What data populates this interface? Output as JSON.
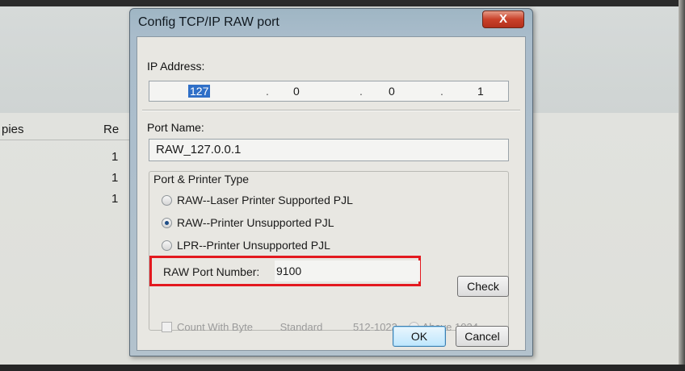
{
  "background": {
    "column_headers": [
      "pies",
      "Re"
    ],
    "rows": [
      "1",
      "1",
      "1"
    ]
  },
  "dialog": {
    "title": "Config TCP/IP RAW port",
    "close_label": "X",
    "ip_label": "IP Address:",
    "ip": [
      "127",
      "0",
      "0",
      "1"
    ],
    "port_name_label": "Port Name:",
    "port_name": "RAW_127.0.0.1",
    "group_title": "Port & Printer Type",
    "options": [
      {
        "label": "RAW--Laser Printer Supported PJL",
        "selected": false
      },
      {
        "label": "RAW--Printer Unsupported PJL",
        "selected": true
      },
      {
        "label": "LPR--Printer Unsupported PJL",
        "selected": false
      }
    ],
    "raw_port_label": "RAW Port Number:",
    "raw_port_value": "9100",
    "check_label": "Check",
    "count_with_byte": "Count With Byte",
    "standard": "Standard",
    "range": "512-1023",
    "above": "Above 1024",
    "ok_label": "OK",
    "cancel_label": "Cancel"
  },
  "colors": {
    "highlight_box": "#e3191f",
    "ip_selection": "#2f6fc7",
    "close_button": "#c9412a"
  }
}
